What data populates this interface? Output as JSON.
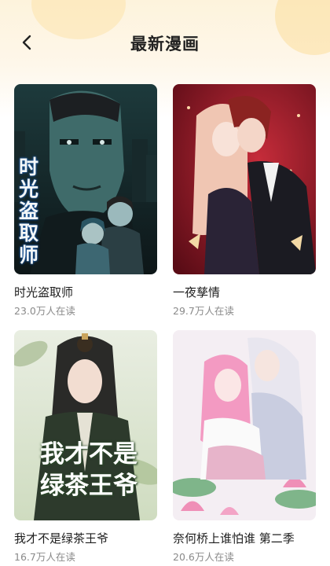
{
  "header": {
    "title": "最新漫画",
    "back_icon": "chevron-left-icon"
  },
  "comics": [
    {
      "title": "时光盗取师",
      "readers": "23.0万人在读",
      "cover_text": "时光盗取师"
    },
    {
      "title": "一夜孳情",
      "readers": "29.7万人在读",
      "cover_text": ""
    },
    {
      "title": "我才不是绿茶王爷",
      "readers": "16.7万人在读",
      "cover_text_line1": "我才不是",
      "cover_text_line2": "绿茶王爷"
    },
    {
      "title": "奈何桥上谁怕谁 第二季",
      "readers": "20.6万人在读",
      "cover_text": ""
    }
  ],
  "colors": {
    "header_bg": "#fdf3dc",
    "title_text": "#222222",
    "subtitle_text": "#8a8a8a"
  }
}
